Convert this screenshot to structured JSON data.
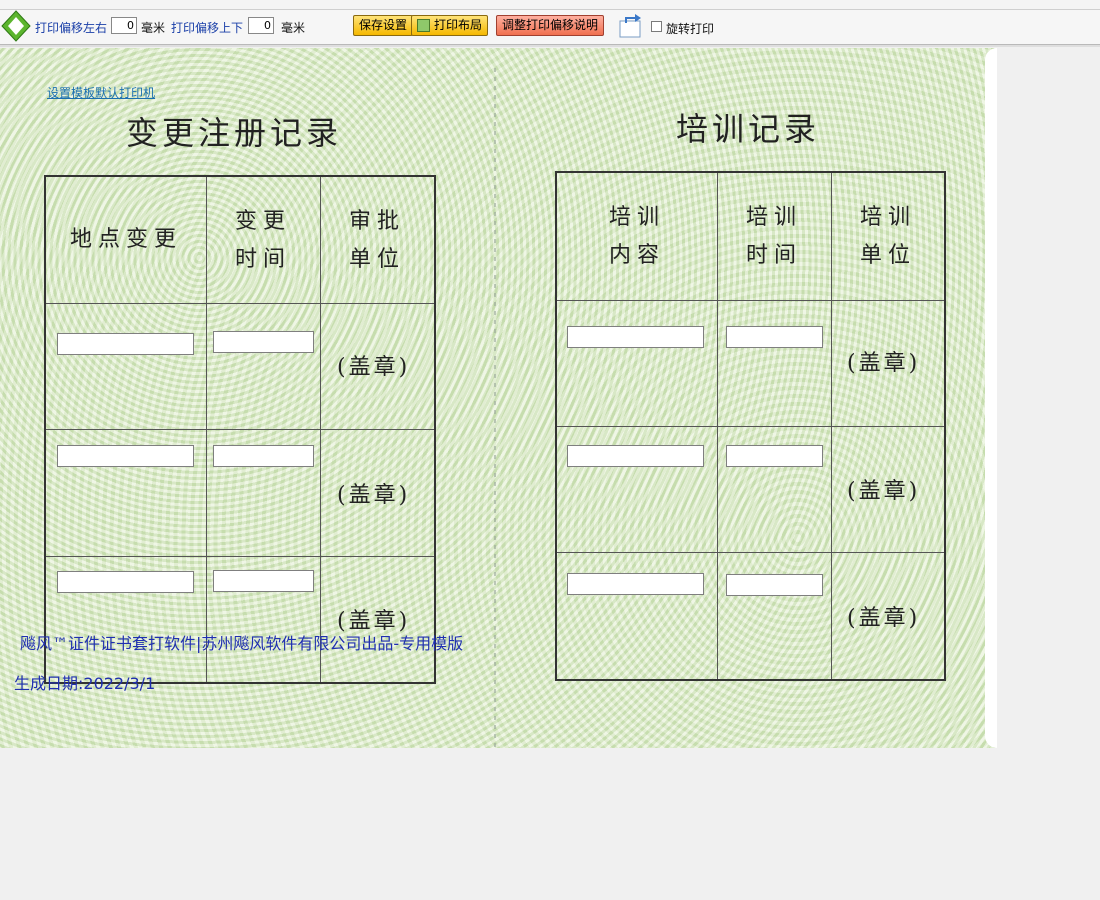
{
  "toolbar": {
    "offset_left_label": "打印偏移左右",
    "offset_left_value": "0",
    "unit_mm_1": "毫米",
    "offset_top_label": "打印偏移上下",
    "offset_top_value": "0",
    "unit_mm_2": "毫米",
    "save_button": "保存设置",
    "layout_button": "打印布局",
    "adjust_button": "调整打印偏移说明",
    "rotate_label": "旋转打印"
  },
  "document": {
    "printer_link": "设置模板默认打印机",
    "left_title": "变更注册记录",
    "right_title": "培训记录",
    "left_headers": [
      "地点变更",
      "变更\n时间",
      "审批\n单位"
    ],
    "right_headers": [
      "培训\n内容",
      "培训\n时间",
      "培训\n单位"
    ],
    "stamp_text": "(盖章)",
    "footer_line1": "飚风™证件证书套打软件|苏州飚风软件有限公司出品-专用模版",
    "footer_line2": "生成日期:2022/3/1"
  },
  "colors": {
    "toolbar_label": "#1a3fa8",
    "footer_text": "#1f2fb0",
    "paper_green": "#dcebc6"
  }
}
